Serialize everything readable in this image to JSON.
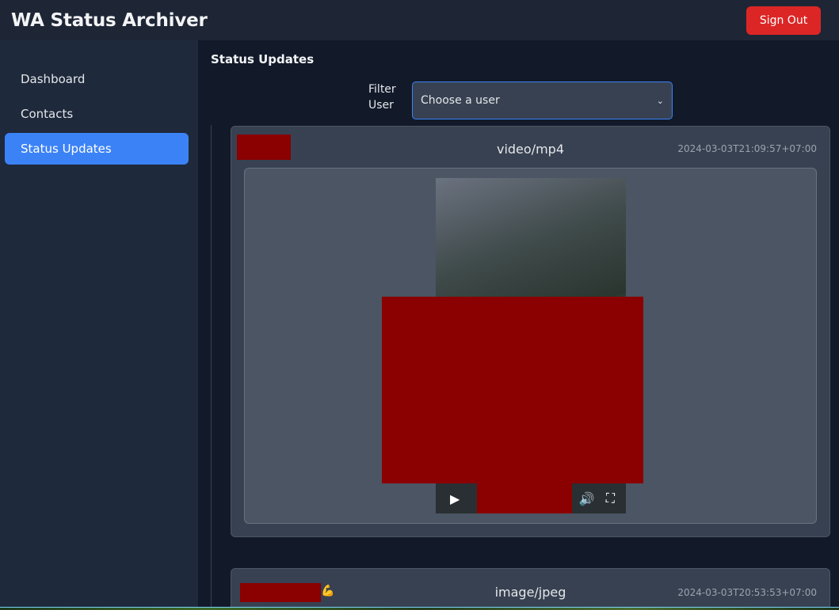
{
  "header": {
    "title": "WA Status Archiver",
    "sign_out": "Sign Out"
  },
  "sidebar": {
    "items": [
      {
        "label": "Dashboard",
        "active": false
      },
      {
        "label": "Contacts",
        "active": false
      },
      {
        "label": "Status Updates",
        "active": true
      }
    ]
  },
  "main": {
    "heading": "Status Updates",
    "filter": {
      "label": "Filter User",
      "selected": "Choose a user"
    },
    "cards": [
      {
        "mime": "video/mp4",
        "timestamp": "2024-03-03T21:09:57+07:00"
      },
      {
        "mime": "image/jpeg",
        "timestamp": "2024-03-03T20:53:53+07:00",
        "emoji": "💪"
      }
    ]
  },
  "colors": {
    "accent": "#3b82f6",
    "danger": "#dc2626",
    "redaction": "#8b0000"
  },
  "icons": {
    "play": "play-icon",
    "volume": "volume-icon",
    "fullscreen": "fullscreen-icon",
    "chevron": "chevron-down-icon"
  }
}
